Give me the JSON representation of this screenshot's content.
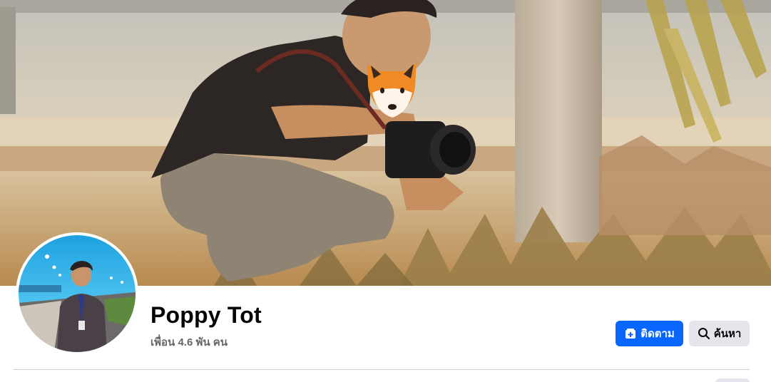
{
  "profile": {
    "name": "Poppy Tot",
    "friends_text": "เพื่อน 4.6 พัน คน"
  },
  "actions": {
    "follow_label": "ติดตาม",
    "search_label": "ค้นหา"
  },
  "colors": {
    "primary_button": "#0866ff",
    "secondary_button": "#e4e6eb",
    "name_text": "#050505",
    "muted_text": "#65676b"
  },
  "icons": {
    "follow": "add-friend-icon",
    "search": "search-icon",
    "cover_sticker": "fox-emoji"
  }
}
